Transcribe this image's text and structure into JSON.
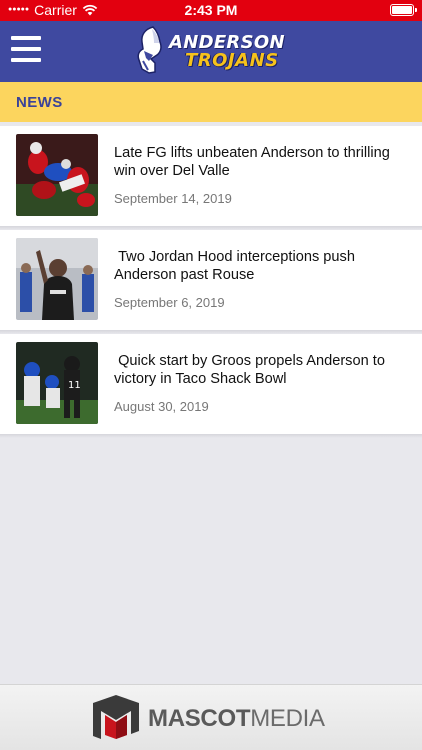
{
  "status_bar": {
    "carrier": "Carrier",
    "time": "2:43 PM"
  },
  "nav": {
    "logo_line1": "ANDERSON",
    "logo_line2": "TROJANS",
    "brand_colors": {
      "primary": "#3f49a0",
      "accent": "#f6c21c",
      "status": "#e2000f"
    }
  },
  "section": {
    "title": "NEWS"
  },
  "news": [
    {
      "title": "Late FG lifts unbeaten Anderson to thrilling win over Del Valle",
      "date": "September 14, 2019"
    },
    {
      "title": " Two Jordan Hood interceptions push Anderson past Rouse",
      "date": "September 6, 2019"
    },
    {
      "title": " Quick start by Groos propels Anderson to victory in Taco Shack Bowl",
      "date": "August 30, 2019"
    }
  ],
  "footer": {
    "brand_bold": "MASCOT",
    "brand_light": "MEDIA"
  }
}
